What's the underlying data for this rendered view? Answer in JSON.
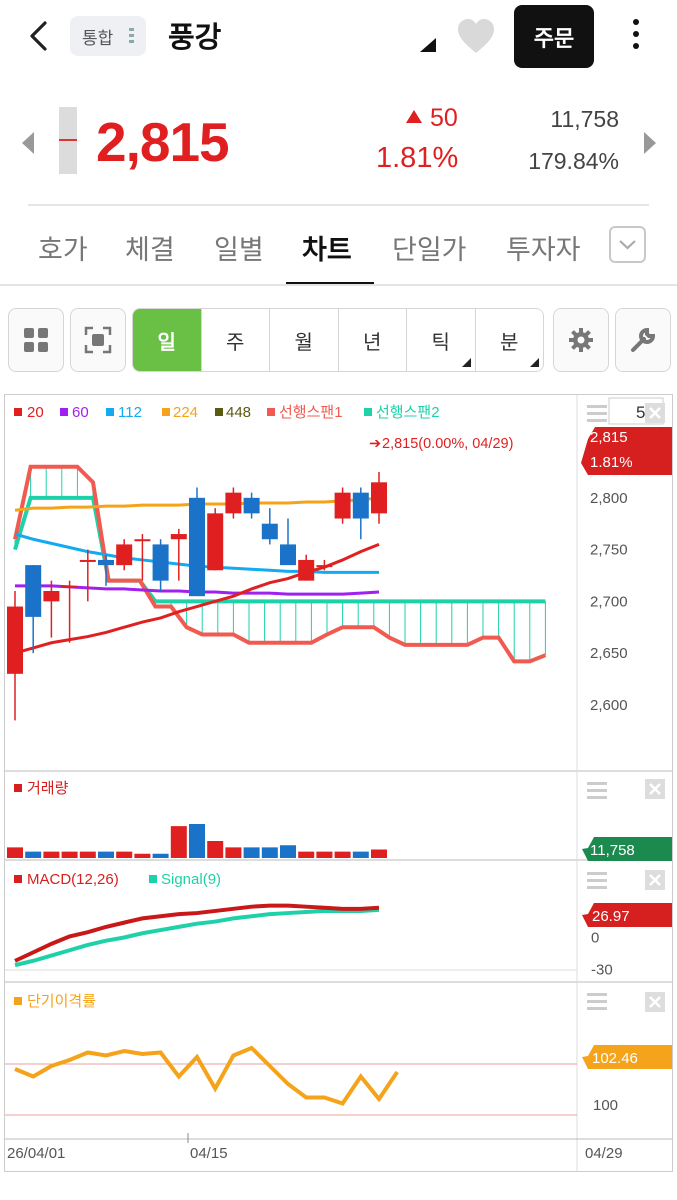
{
  "header": {
    "market_badge": "통합",
    "stock_name": "풍강",
    "order_label": "주문"
  },
  "quote": {
    "price": "2,815",
    "change": "50",
    "change_rate": "1.81%",
    "volume": "11,758",
    "volume_rate": "179.84%"
  },
  "tabs": [
    {
      "label": "호가"
    },
    {
      "label": "체결"
    },
    {
      "label": "일별"
    },
    {
      "label": "차트"
    },
    {
      "label": "단일가"
    },
    {
      "label": "투자자"
    }
  ],
  "periods": [
    {
      "label": "일"
    },
    {
      "label": "주"
    },
    {
      "label": "월"
    },
    {
      "label": "년"
    },
    {
      "label": "틱"
    },
    {
      "label": "분"
    }
  ],
  "colors": {
    "up": "#e02020",
    "down": "#1a73c8",
    "ma20": "#e02020",
    "ma60": "#a020f0",
    "ma112": "#14aaf0",
    "ma224": "#f5a31a",
    "ma448": "#5a5a10",
    "span1": "#f05a50",
    "span2": "#1fd1a8",
    "period_active": "#6abf45"
  },
  "chart_data": {
    "main": {
      "type": "candlestick",
      "legend": [
        "20",
        "60",
        "112",
        "224",
        "448",
        "선행스팬1",
        "선행스팬2"
      ],
      "count_box": "5",
      "last_label": "2,815(0.00%, 04/29)",
      "price_tag": "2,815",
      "price_tag_rate": "1.81%",
      "y_ticks": [
        "2,800",
        "2,750",
        "2,700",
        "2,650",
        "2,600"
      ],
      "y_tick_values": [
        2800,
        2750,
        2700,
        2650,
        2600
      ],
      "ylim": [
        2540,
        2880
      ],
      "candles": [
        {
          "o": 2630,
          "h": 2710,
          "l": 2585,
          "c": 2695
        },
        {
          "o": 2735,
          "h": 2735,
          "l": 2650,
          "c": 2685
        },
        {
          "o": 2700,
          "h": 2720,
          "l": 2665,
          "c": 2710
        },
        {
          "o": 2715,
          "h": 2720,
          "l": 2660,
          "c": 2715
        },
        {
          "o": 2740,
          "h": 2750,
          "l": 2700,
          "c": 2740
        },
        {
          "o": 2740,
          "h": 2745,
          "l": 2715,
          "c": 2735
        },
        {
          "o": 2735,
          "h": 2760,
          "l": 2730,
          "c": 2755
        },
        {
          "o": 2760,
          "h": 2765,
          "l": 2720,
          "c": 2760
        },
        {
          "o": 2755,
          "h": 2760,
          "l": 2710,
          "c": 2720
        },
        {
          "o": 2760,
          "h": 2770,
          "l": 2720,
          "c": 2765
        },
        {
          "o": 2800,
          "h": 2810,
          "l": 2710,
          "c": 2705
        },
        {
          "o": 2730,
          "h": 2790,
          "l": 2730,
          "c": 2785
        },
        {
          "o": 2785,
          "h": 2810,
          "l": 2780,
          "c": 2805
        },
        {
          "o": 2800,
          "h": 2805,
          "l": 2780,
          "c": 2785
        },
        {
          "o": 2775,
          "h": 2790,
          "l": 2755,
          "c": 2760
        },
        {
          "o": 2755,
          "h": 2780,
          "l": 2740,
          "c": 2735
        },
        {
          "o": 2720,
          "h": 2745,
          "l": 2720,
          "c": 2740
        },
        {
          "o": 2735,
          "h": 2740,
          "l": 2730,
          "c": 2735
        },
        {
          "o": 2780,
          "h": 2810,
          "l": 2775,
          "c": 2805
        },
        {
          "o": 2805,
          "h": 2810,
          "l": 2760,
          "c": 2780
        },
        {
          "o": 2785,
          "h": 2825,
          "l": 2775,
          "c": 2815
        }
      ],
      "ma20": [
        2650,
        2655,
        2660,
        2663,
        2666,
        2670,
        2675,
        2680,
        2684,
        2690,
        2695,
        2700,
        2705,
        2712,
        2718,
        2722,
        2728,
        2733,
        2740,
        2748,
        2755
      ],
      "ma60": [
        2715,
        2715,
        2715,
        2714,
        2713,
        2712,
        2712,
        2711,
        2710,
        2710,
        2709,
        2709,
        2708,
        2708,
        2708,
        2707,
        2707,
        2707,
        2707,
        2708,
        2709
      ],
      "ma112": [
        2765,
        2760,
        2756,
        2752,
        2748,
        2745,
        2742,
        2740,
        2738,
        2736,
        2734,
        2733,
        2732,
        2731,
        2730,
        2729,
        2729,
        2728,
        2728,
        2728,
        2728
      ],
      "ma224": [
        2788,
        2790,
        2790,
        2791,
        2791,
        2792,
        2792,
        2793,
        2793,
        2793,
        2794,
        2794,
        2794,
        2795,
        2795,
        2795,
        2796,
        2796,
        2797,
        2798,
        2800
      ],
      "span1": [
        2760,
        2830,
        2830,
        2830,
        2830,
        2815,
        2720,
        2720,
        2720,
        2695,
        2695,
        2675,
        2668,
        2668,
        2668,
        2660,
        2660,
        2660,
        2660,
        2660,
        2668,
        2675,
        2675,
        2675,
        2665,
        2658,
        2658,
        2658,
        2658,
        2658,
        2665,
        2665,
        2642,
        2642,
        2648
      ],
      "span2": [
        2750,
        2800,
        2800,
        2800,
        2800,
        2800,
        2720,
        2720,
        2720,
        2700,
        2700,
        2700,
        2700,
        2700,
        2700,
        2700,
        2700,
        2700,
        2700,
        2700,
        2700,
        2700,
        2700,
        2700,
        2700,
        2700,
        2700,
        2700,
        2700,
        2700,
        2700,
        2700,
        2700,
        2700,
        2700
      ],
      "cloud_step": 32
    },
    "volume": {
      "type": "bar",
      "label": "거래량",
      "tag": "11,758",
      "values": [
        5,
        3,
        3,
        3,
        3,
        3,
        3,
        2,
        2,
        15,
        16,
        8,
        5,
        5,
        5,
        6,
        3,
        3,
        3,
        3,
        4
      ]
    },
    "macd": {
      "type": "line",
      "label": "MACD(12,26)",
      "signal_label": "Signal(9)",
      "tag": "26.97",
      "y_ticks": [
        "0",
        "-30"
      ],
      "y_tick_values": [
        0,
        -30
      ],
      "ylim": [
        -40,
        40
      ],
      "macd": [
        -22,
        -14,
        -6,
        1,
        5,
        10,
        14,
        18,
        20,
        22,
        23,
        25,
        27,
        29,
        30,
        30,
        29,
        28,
        27,
        27,
        28
      ],
      "signal": [
        -26,
        -22,
        -17,
        -12,
        -7,
        -3,
        0,
        4,
        7,
        10,
        13,
        15,
        18,
        20,
        22,
        23,
        24,
        25,
        25,
        25,
        26
      ]
    },
    "disparity": {
      "type": "line",
      "label": "단기이격률",
      "tag": "102.46",
      "y_ticks": [
        "100"
      ],
      "y_tick_values": [
        100
      ],
      "ylim": [
        98,
        106
      ],
      "values": [
        102.4,
        101.9,
        102.6,
        103.0,
        103.5,
        103.3,
        103.6,
        103.4,
        103.5,
        101.9,
        103.2,
        101.1,
        103.3,
        103.8,
        102.6,
        101.4,
        100.5,
        100.5,
        100.1,
        101.9,
        100.4,
        102.2
      ]
    },
    "x_labels": [
      "26/04/01",
      "04/15",
      "04/29"
    ]
  }
}
